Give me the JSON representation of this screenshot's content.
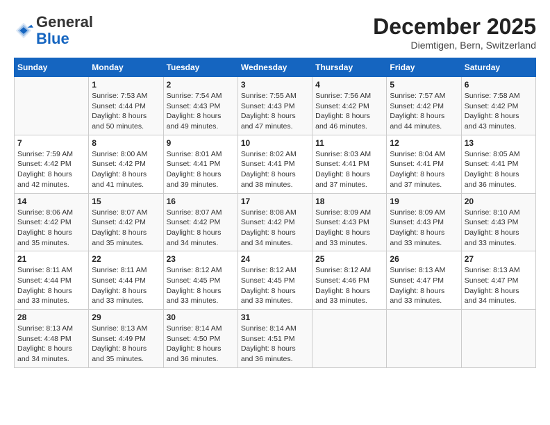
{
  "header": {
    "logo_general": "General",
    "logo_blue": "Blue",
    "month_title": "December 2025",
    "location": "Diemtigen, Bern, Switzerland"
  },
  "days_of_week": [
    "Sunday",
    "Monday",
    "Tuesday",
    "Wednesday",
    "Thursday",
    "Friday",
    "Saturday"
  ],
  "weeks": [
    [
      {
        "day": "",
        "info": ""
      },
      {
        "day": "1",
        "info": "Sunrise: 7:53 AM\nSunset: 4:44 PM\nDaylight: 8 hours\nand 50 minutes."
      },
      {
        "day": "2",
        "info": "Sunrise: 7:54 AM\nSunset: 4:43 PM\nDaylight: 8 hours\nand 49 minutes."
      },
      {
        "day": "3",
        "info": "Sunrise: 7:55 AM\nSunset: 4:43 PM\nDaylight: 8 hours\nand 47 minutes."
      },
      {
        "day": "4",
        "info": "Sunrise: 7:56 AM\nSunset: 4:42 PM\nDaylight: 8 hours\nand 46 minutes."
      },
      {
        "day": "5",
        "info": "Sunrise: 7:57 AM\nSunset: 4:42 PM\nDaylight: 8 hours\nand 44 minutes."
      },
      {
        "day": "6",
        "info": "Sunrise: 7:58 AM\nSunset: 4:42 PM\nDaylight: 8 hours\nand 43 minutes."
      }
    ],
    [
      {
        "day": "7",
        "info": "Sunrise: 7:59 AM\nSunset: 4:42 PM\nDaylight: 8 hours\nand 42 minutes."
      },
      {
        "day": "8",
        "info": "Sunrise: 8:00 AM\nSunset: 4:42 PM\nDaylight: 8 hours\nand 41 minutes."
      },
      {
        "day": "9",
        "info": "Sunrise: 8:01 AM\nSunset: 4:41 PM\nDaylight: 8 hours\nand 39 minutes."
      },
      {
        "day": "10",
        "info": "Sunrise: 8:02 AM\nSunset: 4:41 PM\nDaylight: 8 hours\nand 38 minutes."
      },
      {
        "day": "11",
        "info": "Sunrise: 8:03 AM\nSunset: 4:41 PM\nDaylight: 8 hours\nand 37 minutes."
      },
      {
        "day": "12",
        "info": "Sunrise: 8:04 AM\nSunset: 4:41 PM\nDaylight: 8 hours\nand 37 minutes."
      },
      {
        "day": "13",
        "info": "Sunrise: 8:05 AM\nSunset: 4:41 PM\nDaylight: 8 hours\nand 36 minutes."
      }
    ],
    [
      {
        "day": "14",
        "info": "Sunrise: 8:06 AM\nSunset: 4:42 PM\nDaylight: 8 hours\nand 35 minutes."
      },
      {
        "day": "15",
        "info": "Sunrise: 8:07 AM\nSunset: 4:42 PM\nDaylight: 8 hours\nand 35 minutes."
      },
      {
        "day": "16",
        "info": "Sunrise: 8:07 AM\nSunset: 4:42 PM\nDaylight: 8 hours\nand 34 minutes."
      },
      {
        "day": "17",
        "info": "Sunrise: 8:08 AM\nSunset: 4:42 PM\nDaylight: 8 hours\nand 34 minutes."
      },
      {
        "day": "18",
        "info": "Sunrise: 8:09 AM\nSunset: 4:43 PM\nDaylight: 8 hours\nand 33 minutes."
      },
      {
        "day": "19",
        "info": "Sunrise: 8:09 AM\nSunset: 4:43 PM\nDaylight: 8 hours\nand 33 minutes."
      },
      {
        "day": "20",
        "info": "Sunrise: 8:10 AM\nSunset: 4:43 PM\nDaylight: 8 hours\nand 33 minutes."
      }
    ],
    [
      {
        "day": "21",
        "info": "Sunrise: 8:11 AM\nSunset: 4:44 PM\nDaylight: 8 hours\nand 33 minutes."
      },
      {
        "day": "22",
        "info": "Sunrise: 8:11 AM\nSunset: 4:44 PM\nDaylight: 8 hours\nand 33 minutes."
      },
      {
        "day": "23",
        "info": "Sunrise: 8:12 AM\nSunset: 4:45 PM\nDaylight: 8 hours\nand 33 minutes."
      },
      {
        "day": "24",
        "info": "Sunrise: 8:12 AM\nSunset: 4:45 PM\nDaylight: 8 hours\nand 33 minutes."
      },
      {
        "day": "25",
        "info": "Sunrise: 8:12 AM\nSunset: 4:46 PM\nDaylight: 8 hours\nand 33 minutes."
      },
      {
        "day": "26",
        "info": "Sunrise: 8:13 AM\nSunset: 4:47 PM\nDaylight: 8 hours\nand 33 minutes."
      },
      {
        "day": "27",
        "info": "Sunrise: 8:13 AM\nSunset: 4:47 PM\nDaylight: 8 hours\nand 34 minutes."
      }
    ],
    [
      {
        "day": "28",
        "info": "Sunrise: 8:13 AM\nSunset: 4:48 PM\nDaylight: 8 hours\nand 34 minutes."
      },
      {
        "day": "29",
        "info": "Sunrise: 8:13 AM\nSunset: 4:49 PM\nDaylight: 8 hours\nand 35 minutes."
      },
      {
        "day": "30",
        "info": "Sunrise: 8:14 AM\nSunset: 4:50 PM\nDaylight: 8 hours\nand 36 minutes."
      },
      {
        "day": "31",
        "info": "Sunrise: 8:14 AM\nSunset: 4:51 PM\nDaylight: 8 hours\nand 36 minutes."
      },
      {
        "day": "",
        "info": ""
      },
      {
        "day": "",
        "info": ""
      },
      {
        "day": "",
        "info": ""
      }
    ]
  ]
}
